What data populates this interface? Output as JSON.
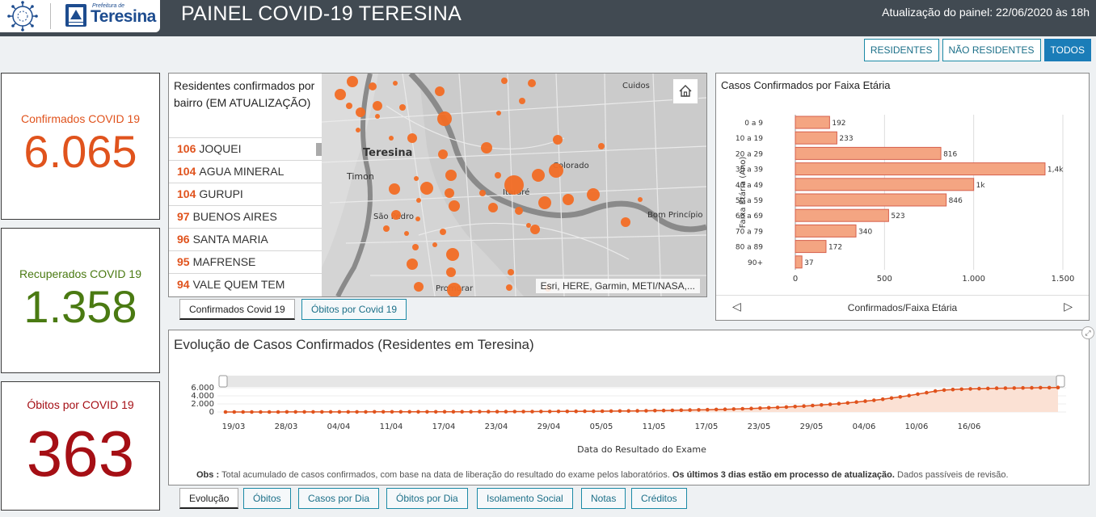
{
  "header": {
    "logo_prefix": "Prefeitura de",
    "logo_city": "Teresina",
    "title": "PAINEL COVID-19 TERESINA",
    "update": "Atualização do painel: 22/06/2020 às 18h"
  },
  "filters": [
    {
      "label": "RESIDENTES",
      "active": false
    },
    {
      "label": "NÃO RESIDENTES",
      "active": false
    },
    {
      "label": "TODOS",
      "active": true
    }
  ],
  "kpis": [
    {
      "label": "Confirmados COVID 19",
      "value": "6.065",
      "color": "#e0531d"
    },
    {
      "label": "Recuperados COVID 19",
      "value": "1.358",
      "color": "#4a7a12"
    },
    {
      "label": "Óbitos por COVID 19",
      "value": "363",
      "color": "#a50f15"
    }
  ],
  "neighborhoods": {
    "title": "Residentes confirmados por bairro (EM ATUALIZAÇÃO)",
    "items": [
      {
        "count": "106",
        "name": "JOQUEI"
      },
      {
        "count": "104",
        "name": "AGUA MINERAL"
      },
      {
        "count": "104",
        "name": "GURUPI"
      },
      {
        "count": "97",
        "name": "BUENOS AIRES"
      },
      {
        "count": "96",
        "name": "SANTA MARIA"
      },
      {
        "count": "95",
        "name": "MAFRENSE"
      },
      {
        "count": "94",
        "name": "VALE QUEM TEM"
      }
    ]
  },
  "map": {
    "labels": [
      "Cuidos",
      "Teresina",
      "Timon",
      "Colorado",
      "Itararé",
      "São Pedro",
      "Bom Princípio",
      "Promorar"
    ],
    "attribution": "Esri, HERE, Garmin, METI/NASA,..."
  },
  "map_tabs": [
    "Confirmados Covid 19",
    "Óbitos por Covid 19"
  ],
  "chart_data": [
    {
      "type": "bar",
      "title": "Casos Confirmados por Faixa Etária",
      "ylabel": "Faixa Etária (Ano)",
      "footer": "Confirmados/Faixa Etária",
      "categories": [
        "0 a 9",
        "10 a 19",
        "20 a 29",
        "30 a 39",
        "40 a 49",
        "50 a 59",
        "60 a 69",
        "70 a 79",
        "80 a 89",
        "90+"
      ],
      "values": [
        192,
        233,
        816,
        1400,
        1000,
        846,
        523,
        340,
        172,
        37
      ],
      "value_labels": [
        "192",
        "233",
        "816",
        "1,4k",
        "1k",
        "846",
        "523",
        "340",
        "172",
        "37"
      ],
      "xticks": [
        "0",
        "500",
        "1.000",
        "1.500"
      ],
      "xlim": [
        0,
        1500
      ],
      "orientation": "horizontal",
      "color": "#f4a582"
    },
    {
      "type": "line",
      "title": "Evolução de Casos Confirmados (Residentes em Teresina)",
      "xlabel": "Data do Resultado do Exame",
      "xticks": [
        "19/03",
        "28/03",
        "04/04",
        "11/04",
        "17/04",
        "23/04",
        "29/04",
        "05/05",
        "11/05",
        "17/05",
        "23/05",
        "29/05",
        "04/06",
        "10/06",
        "16/06"
      ],
      "yticks": [
        "6.000",
        "4.000",
        "2.000",
        "0"
      ],
      "ylim": [
        0,
        6000
      ],
      "x_start": "19/03",
      "x_end": "22/06",
      "values": [
        3,
        4,
        5,
        6,
        8,
        9,
        10,
        12,
        13,
        15,
        17,
        19,
        21,
        23,
        25,
        27,
        29,
        31,
        33,
        36,
        38,
        40,
        43,
        46,
        50,
        54,
        58,
        62,
        66,
        70,
        75,
        80,
        86,
        92,
        99,
        107,
        115,
        124,
        134,
        145,
        157,
        170,
        184,
        200,
        217,
        236,
        257,
        280,
        305,
        332,
        362,
        395,
        431,
        470,
        513,
        560,
        611,
        667,
        728,
        795,
        867,
        946,
        1032,
        1126,
        1228,
        1340,
        1461,
        1593,
        1737,
        1894,
        2064,
        2250,
        2451,
        2670,
        2907,
        3164,
        3442,
        3742,
        4066,
        4414,
        4789,
        5190,
        5420,
        5560,
        5650,
        5720,
        5780,
        5830,
        5870,
        5900,
        5930,
        5960,
        5990,
        6010,
        6030,
        6065
      ],
      "color": "#e0531d"
    }
  ],
  "evolution_note": {
    "bold_lead": "Obs : ",
    "text": "Total acumulado de casos confirmados, com base na data de liberação do resultado do exame pelos laboratórios.",
    "bold_mid": "Os últimos 3 dias estão em processo de atualização.",
    "tail": "Dados passíveis de revisão."
  },
  "bottom_tabs": [
    "Evolução",
    "Óbitos",
    "Casos por Dia",
    "Óbitos por Dia",
    "Isolamento Social",
    "Notas",
    "Créditos"
  ]
}
